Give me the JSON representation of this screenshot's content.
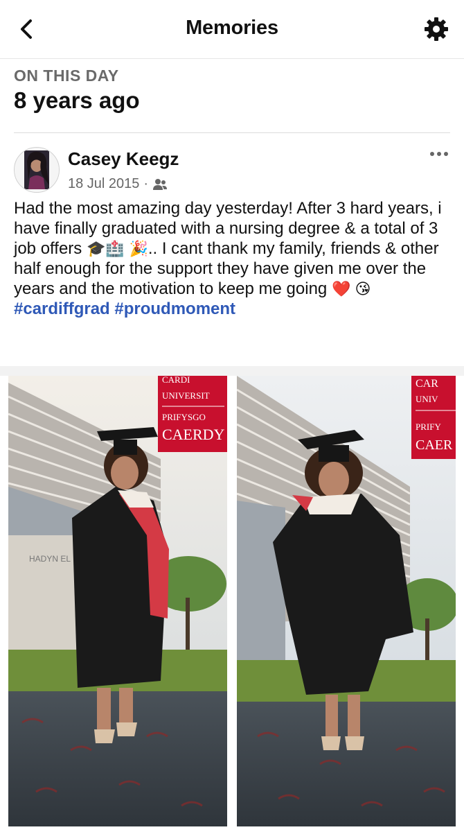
{
  "header": {
    "title": "Memories",
    "back_icon": "chevron-left-icon",
    "settings_icon": "gear-icon"
  },
  "memory": {
    "label": "ON THIS DAY",
    "ago": "8 years ago"
  },
  "post": {
    "author": "Casey Keegz",
    "date": "18 Jul 2015",
    "separator": "·",
    "audience_icon": "friends-icon",
    "more_icon": "more-dots-icon",
    "text_part1": "Had the most amazing day yesterday! After 3 hard years, i have finally graduated with a nursing degree & a total of 3 job offers",
    "emoji_1": "🎓🏥",
    "emoji_2": "🎉",
    "text_part2": ".. I cant thank my family, friends & other half enough for the support they have given me over the years and the motivation to keep me going",
    "emoji_3": "❤️ 😘",
    "hashtags": [
      "#cardiffgrad",
      "#proudmoment"
    ]
  },
  "photos": [
    {
      "name": "graduation-photo-1",
      "banner_lines": [
        "CARDI",
        "UNIVERSIT",
        "PRIFYSGO",
        "CAERDY"
      ],
      "building_sign": "HADYN EL"
    },
    {
      "name": "graduation-photo-2",
      "banner_lines": [
        "CAR",
        "UNIV",
        "PRIFY",
        "CAER"
      ]
    }
  ],
  "colors": {
    "accent_link": "#2f59b7",
    "banner_red": "#c8102e",
    "gown_black": "#1a1a1a",
    "hood_red": "#d43a45",
    "carpet": "#3b4148"
  }
}
